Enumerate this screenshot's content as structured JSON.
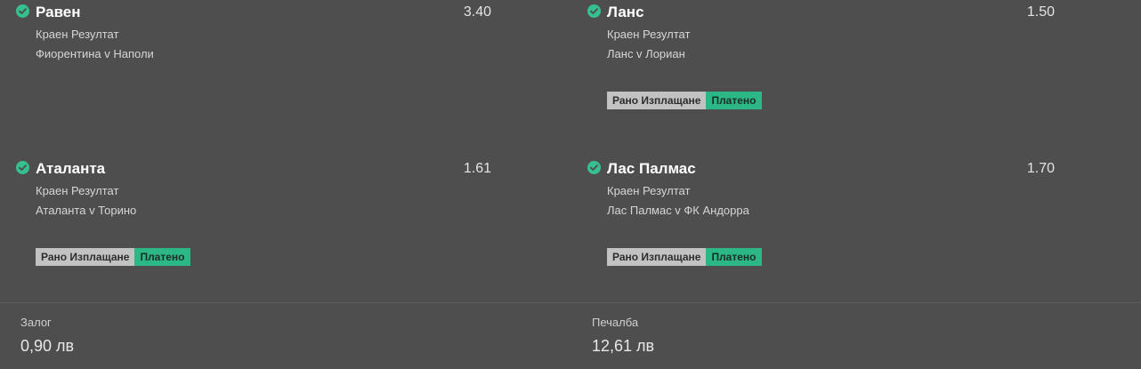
{
  "selections": [
    {
      "name": "Равен",
      "odds": "3.40",
      "market": "Краен Резултат",
      "event": "Фиорентина v Наполи",
      "status_icon": "check-circle-icon"
    },
    {
      "name": "Ланс",
      "odds": "1.50",
      "market": "Краен Резултат",
      "event": "Ланс v Лориан",
      "badges": {
        "early_payout": "Рано Изплащане",
        "paid": "Платено"
      },
      "status_icon": "check-circle-icon"
    },
    {
      "name": "Аталанта",
      "odds": "1.61",
      "market": "Краен Резултат",
      "event": "Аталанта v Торино",
      "badges": {
        "early_payout": "Рано Изплащане",
        "paid": "Платено"
      },
      "status_icon": "check-circle-icon"
    },
    {
      "name": "Лас Палмас",
      "odds": "1.70",
      "market": "Краен Резултат",
      "event": "Лас Палмас v ФК Андорра",
      "badges": {
        "early_payout": "Рано Изплащане",
        "paid": "Платено"
      },
      "status_icon": "check-circle-icon"
    }
  ],
  "summary": {
    "stake_label": "Залог",
    "stake_value": "0,90 лв",
    "winnings_label": "Печалба",
    "winnings_value": "12,61 лв"
  },
  "colors": {
    "background": "#4e4e4e",
    "accent_green": "#35c18f",
    "badge_grey": "#c2c2c2"
  }
}
